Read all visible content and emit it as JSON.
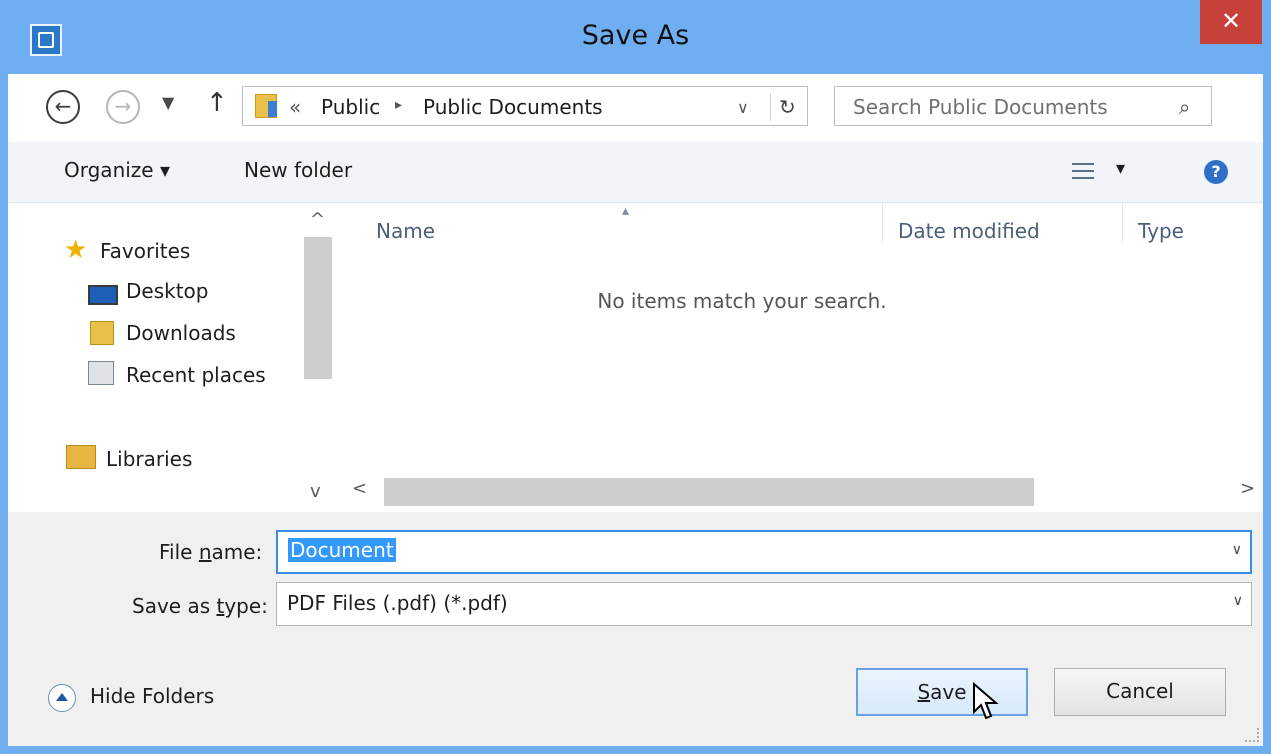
{
  "window": {
    "title": "Save As",
    "close_glyph": "✕"
  },
  "address_bar": {
    "back_glyph": "←",
    "forward_glyph": "→",
    "recent_glyph": "▼",
    "up_glyph": "↑",
    "overflow": "«",
    "breadcrumbs": [
      "Public",
      "Public Documents"
    ],
    "separator": "▸",
    "dropdown_glyph": "∨",
    "refresh_glyph": "↻"
  },
  "search": {
    "placeholder": "Search Public Documents",
    "icon_glyph": "⌕"
  },
  "toolbar": {
    "organize": "Organize ▾",
    "new_folder": "New folder",
    "views_dropdown": "▾",
    "help_glyph": "?"
  },
  "nav_pane": {
    "favorites": "Favorites",
    "items": [
      "Desktop",
      "Downloads",
      "Recent places"
    ],
    "libraries": "Libraries"
  },
  "columns": [
    "Name",
    "Date modified",
    "Type"
  ],
  "sort_glyph": "▴",
  "empty_message": "No items match your search.",
  "scroll": {
    "up": "^",
    "down": "v",
    "left": "<",
    "right": ">"
  },
  "file_name": {
    "label_pre": "File ",
    "label_u": "n",
    "label_post": "ame:",
    "value": "Document"
  },
  "save_type": {
    "label_pre": "Save as ",
    "label_u": "t",
    "label_post": "ype:",
    "value": "PDF Files (.pdf) (*.pdf)"
  },
  "chevron": "∨",
  "hide_folders": "Hide Folders",
  "buttons": {
    "save_u": "S",
    "save_rest": "ave",
    "cancel": "Cancel"
  }
}
